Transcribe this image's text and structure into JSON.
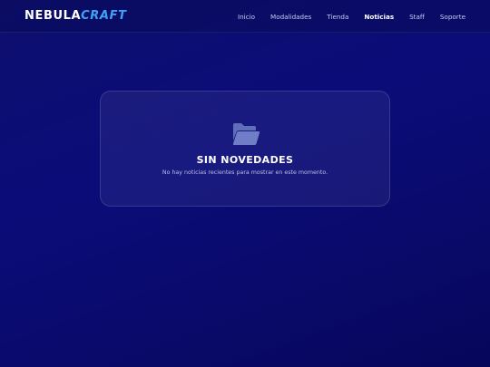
{
  "brand": {
    "part1": "NEBULA",
    "part2": "CRAFT"
  },
  "nav": {
    "items": [
      {
        "label": "Inicio",
        "active": false
      },
      {
        "label": "Modalidades",
        "active": false
      },
      {
        "label": "Tienda",
        "active": false
      },
      {
        "label": "Noticias",
        "active": true
      },
      {
        "label": "Staff",
        "active": false
      },
      {
        "label": "Soporte",
        "active": false
      }
    ]
  },
  "empty_state": {
    "icon": "folder-open-icon",
    "title": "SIN NOVEDADES",
    "message": "No hay noticias recientes para mostrar en este momento."
  },
  "colors": {
    "background": "#0b0c78",
    "accent": "#3fa1f5",
    "text": "#ffffff",
    "muted": "#b9bde8"
  }
}
